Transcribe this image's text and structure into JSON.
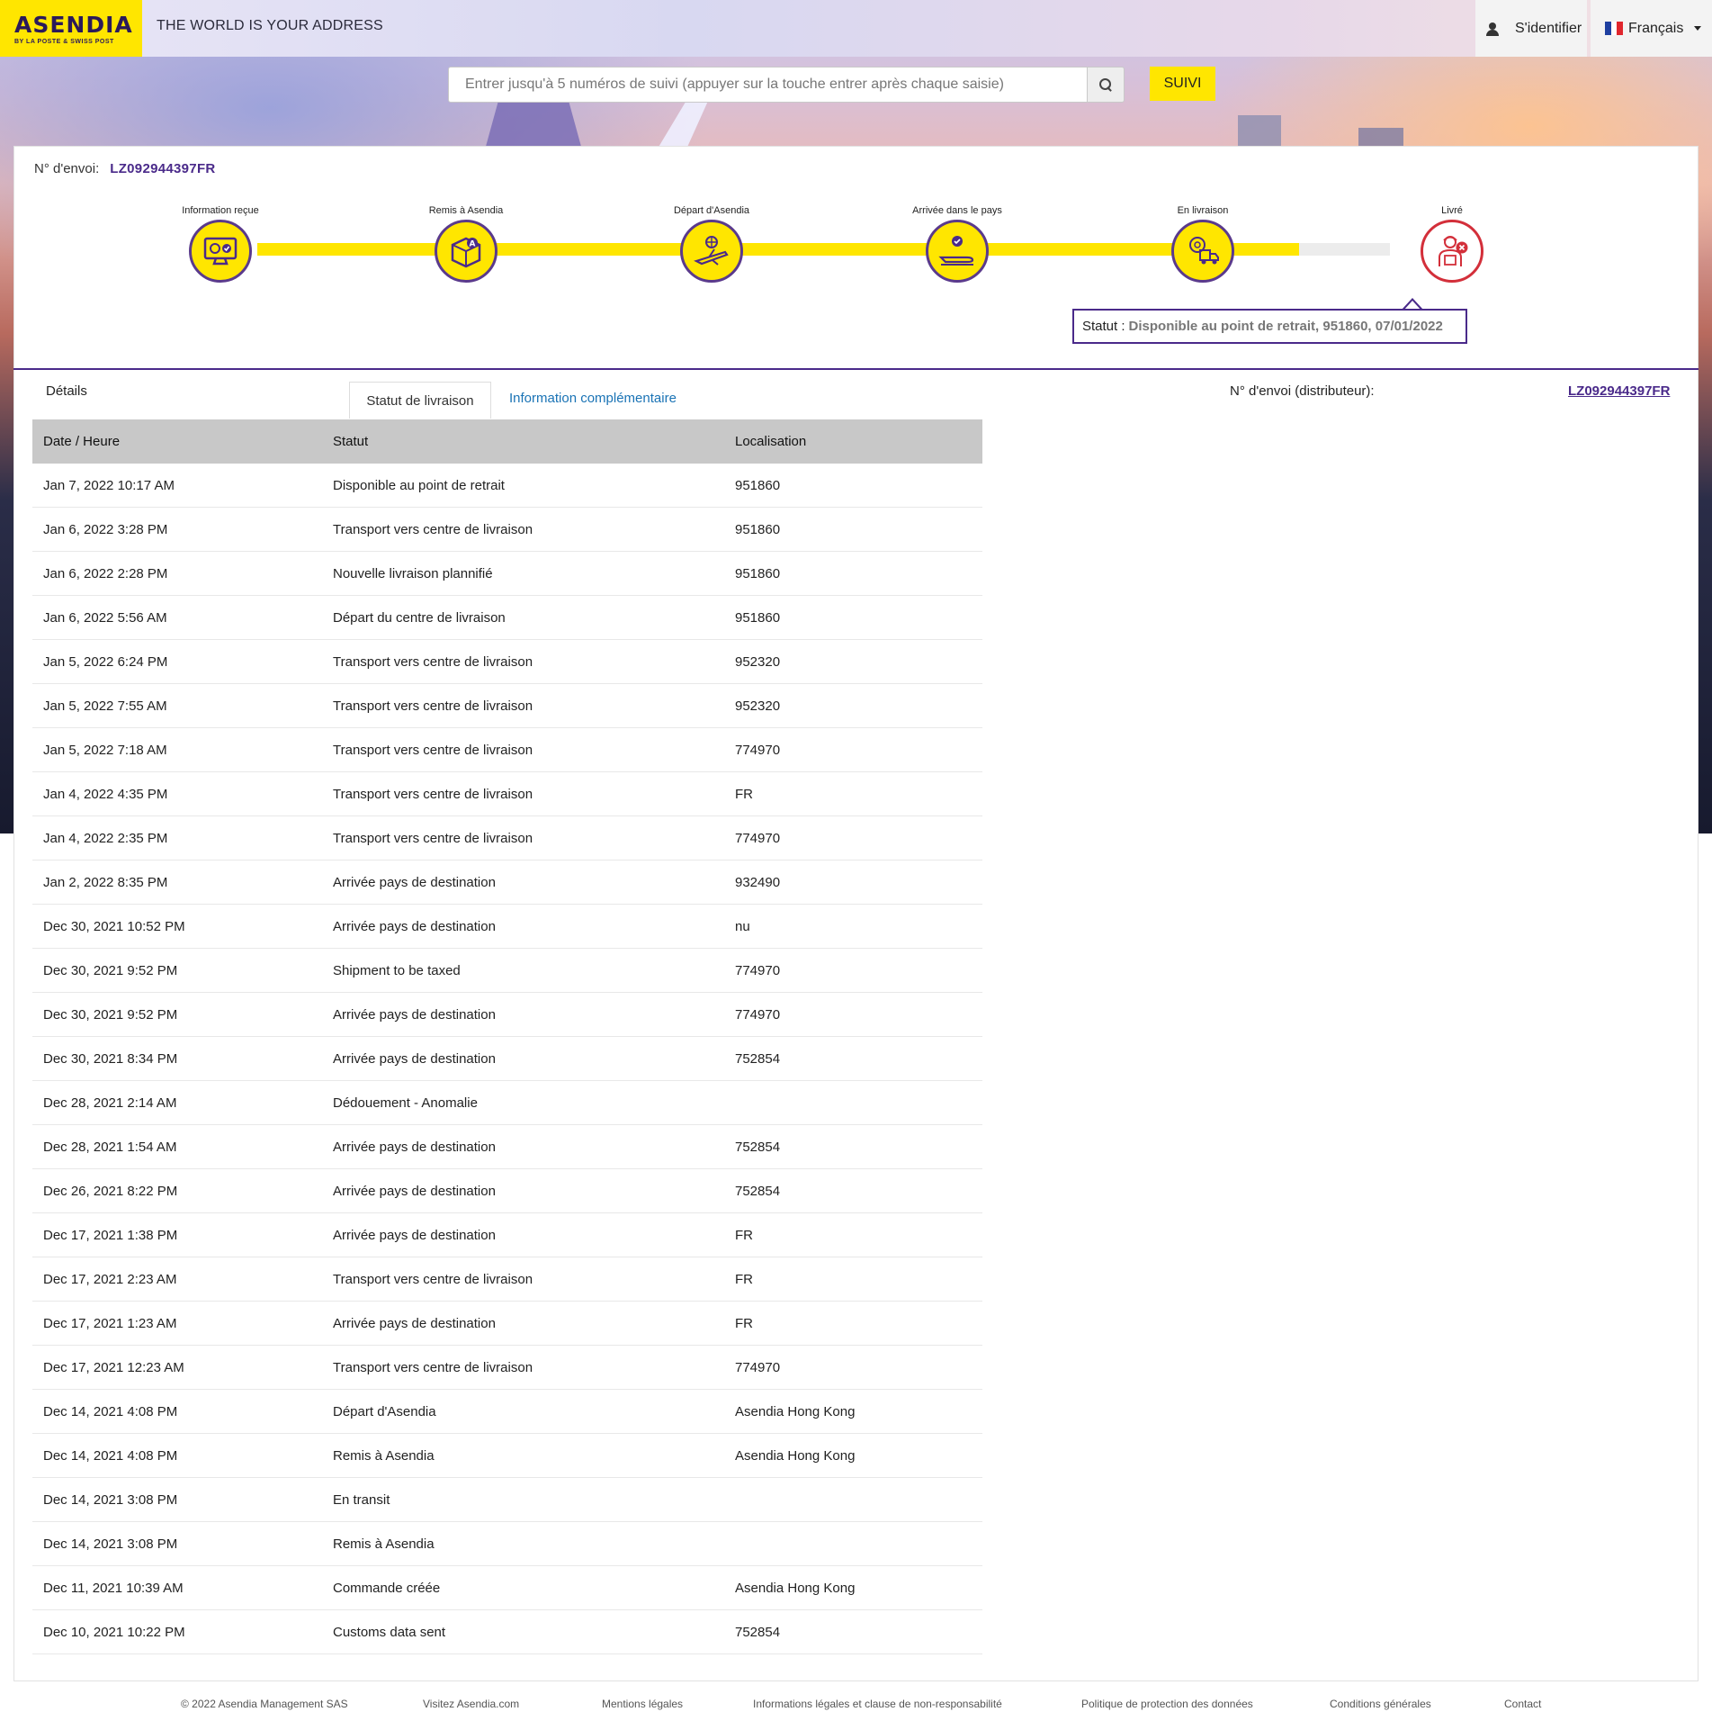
{
  "header": {
    "logo_main": "ASENDIA",
    "logo_sub": "BY LA POSTE & SWISS POST",
    "tagline": "THE WORLD IS YOUR ADDRESS",
    "login_label": "S'identifier",
    "language_label": "Français"
  },
  "search": {
    "placeholder": "Entrer jusqu'à 5 numéros de suivi (appuyer sur la touche entrer après chaque saisie)",
    "button_label": "SUIVI"
  },
  "shipment": {
    "label": "N° d'envoi:",
    "number": "LZ092944397FR"
  },
  "progress": {
    "steps": [
      {
        "label": "Information reçue",
        "icon": "monitor-check-icon"
      },
      {
        "label": "Remis à Asendia",
        "icon": "package-icon"
      },
      {
        "label": "Départ d'Asendia",
        "icon": "plane-departure-icon"
      },
      {
        "label": "Arrivée dans le pays",
        "icon": "plane-arrival-icon"
      },
      {
        "label": "En livraison",
        "icon": "delivery-truck-icon"
      },
      {
        "label": "Livré",
        "icon": "courier-error-icon"
      }
    ],
    "fill_fraction": 0.92,
    "colors": {
      "fill": "#ffe600",
      "border": "#5a3a8c",
      "error": "#d32f3a"
    }
  },
  "status": {
    "label": "Statut :",
    "value": "Disponible au point de retrait, 951860, 07/01/2022"
  },
  "details": {
    "label": "Détails",
    "tabs": [
      {
        "label": "Statut de livraison",
        "active": true
      },
      {
        "label": "Information complémentaire",
        "active": false
      }
    ],
    "distributor_label": "N° d'envoi (distributeur):",
    "distributor_number": "LZ092944397FR"
  },
  "table": {
    "headers": [
      "Date / Heure",
      "Statut",
      "Localisation"
    ],
    "rows": [
      [
        "Jan 7, 2022 10:17 AM",
        "Disponible au point de retrait",
        "951860"
      ],
      [
        "Jan 6, 2022 3:28 PM",
        "Transport vers centre de livraison",
        "951860"
      ],
      [
        "Jan 6, 2022 2:28 PM",
        "Nouvelle livraison plannifié",
        "951860"
      ],
      [
        "Jan 6, 2022 5:56 AM",
        "Départ du centre de livraison",
        "951860"
      ],
      [
        "Jan 5, 2022 6:24 PM",
        "Transport vers centre de livraison",
        "952320"
      ],
      [
        "Jan 5, 2022 7:55 AM",
        "Transport vers centre de livraison",
        "952320"
      ],
      [
        "Jan 5, 2022 7:18 AM",
        "Transport vers centre de livraison",
        "774970"
      ],
      [
        "Jan 4, 2022 4:35 PM",
        "Transport vers centre de livraison",
        "FR"
      ],
      [
        "Jan 4, 2022 2:35 PM",
        "Transport vers centre de livraison",
        "774970"
      ],
      [
        "Jan 2, 2022 8:35 PM",
        "Arrivée pays de destination",
        "932490"
      ],
      [
        "Dec 30, 2021 10:52 PM",
        "Arrivée pays de destination",
        "nu"
      ],
      [
        "Dec 30, 2021 9:52 PM",
        "Shipment to be taxed",
        "774970"
      ],
      [
        "Dec 30, 2021 9:52 PM",
        "Arrivée pays de destination",
        "774970"
      ],
      [
        "Dec 30, 2021 8:34 PM",
        "Arrivée pays de destination",
        "752854"
      ],
      [
        "Dec 28, 2021 2:14 AM",
        "Dédouement - Anomalie",
        ""
      ],
      [
        "Dec 28, 2021 1:54 AM",
        "Arrivée pays de destination",
        "752854"
      ],
      [
        "Dec 26, 2021 8:22 PM",
        "Arrivée pays de destination",
        "752854"
      ],
      [
        "Dec 17, 2021 1:38 PM",
        "Arrivée pays de destination",
        "FR"
      ],
      [
        "Dec 17, 2021 2:23 AM",
        "Transport vers centre de livraison",
        "FR"
      ],
      [
        "Dec 17, 2021 1:23 AM",
        "Arrivée pays de destination",
        "FR"
      ],
      [
        "Dec 17, 2021 12:23 AM",
        "Transport vers centre de livraison",
        "774970"
      ],
      [
        "Dec 14, 2021 4:08 PM",
        "Départ d'Asendia",
        "Asendia Hong Kong"
      ],
      [
        "Dec 14, 2021 4:08 PM",
        "Remis à Asendia",
        "Asendia Hong Kong"
      ],
      [
        "Dec 14, 2021 3:08 PM",
        "En transit",
        ""
      ],
      [
        "Dec 14, 2021 3:08 PM",
        "Remis à Asendia",
        ""
      ],
      [
        "Dec 11, 2021 10:39 AM",
        "Commande créée",
        "Asendia Hong Kong"
      ],
      [
        "Dec 10, 2021 10:22 PM",
        "Customs data sent",
        "752854"
      ]
    ]
  },
  "footer": {
    "links": [
      "© 2022 Asendia Management SAS",
      "Visitez Asendia.com",
      "Mentions légales",
      "Informations légales et clause de non-responsabilité",
      "Politique de protection des données",
      "Conditions générales",
      "Contact"
    ]
  }
}
